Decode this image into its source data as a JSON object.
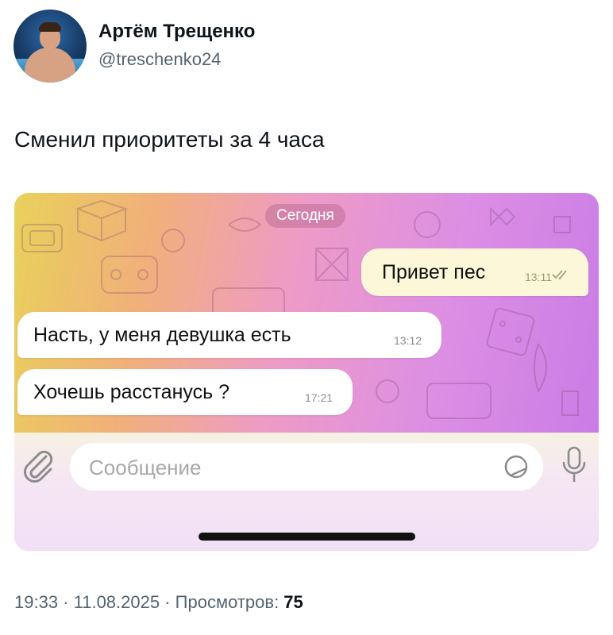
{
  "author": {
    "name": "Артём Трещенко",
    "handle": "@treschenko24"
  },
  "tweet": {
    "text": "Сменил приоритеты за 4 часа"
  },
  "screenshot": {
    "date_separator": "Сегодня",
    "messages": [
      {
        "text": "Привет пес",
        "time": "13:11",
        "direction": "outgoing",
        "status": "read-checkmarks"
      },
      {
        "text": "Насть, у меня девушка есть",
        "time": "13:12",
        "direction": "incoming"
      },
      {
        "text": "Хочешь расстанусь ?",
        "time": "17:21",
        "direction": "incoming"
      }
    ],
    "composer": {
      "placeholder": "Сообщение",
      "attach_icon": "paperclip-icon",
      "sticker_icon": "sticker-icon",
      "mic_icon": "microphone-icon"
    },
    "colors": {
      "outgoing_bubble": "#fbf7d8",
      "incoming_bubble": "#ffffff",
      "wallpaper_left": "#e8d15a",
      "wallpaper_right": "#c87ae6"
    }
  },
  "footer": {
    "time": "19:33",
    "sep1": " · ",
    "date": "11.08.2025",
    "sep2": " · ",
    "views_label": "Просмотров: ",
    "views_count": "75"
  }
}
